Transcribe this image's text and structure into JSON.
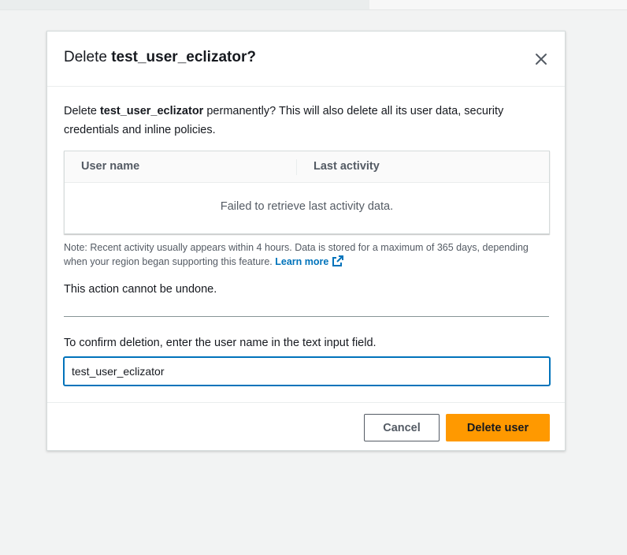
{
  "dialog": {
    "title_prefix": "Delete ",
    "title_username": "test_user_eclizator?",
    "body_prefix": "Delete ",
    "body_username": "test_user_eclizator",
    "body_suffix": " permanently? This will also delete all its user data, security credentials and inline policies.",
    "table": {
      "columns": [
        "User name",
        "Last activity"
      ],
      "empty_message": "Failed to retrieve last activity data."
    },
    "note_text": "Note: Recent activity usually appears within 4 hours. Data is stored for a maximum of 365 days, depending when your region began supporting this feature. ",
    "learn_more": "Learn more",
    "warning": "This action cannot be undone.",
    "confirm_label": "To confirm deletion, enter the user name in the text input field.",
    "confirm_value": "test_user_eclizator",
    "cancel_label": "Cancel",
    "delete_label": "Delete user"
  },
  "colors": {
    "primary_button": "#ff9900",
    "link": "#0073bb",
    "focus_border": "#0073bb"
  },
  "icons": [
    "close-icon",
    "external-link-icon"
  ]
}
